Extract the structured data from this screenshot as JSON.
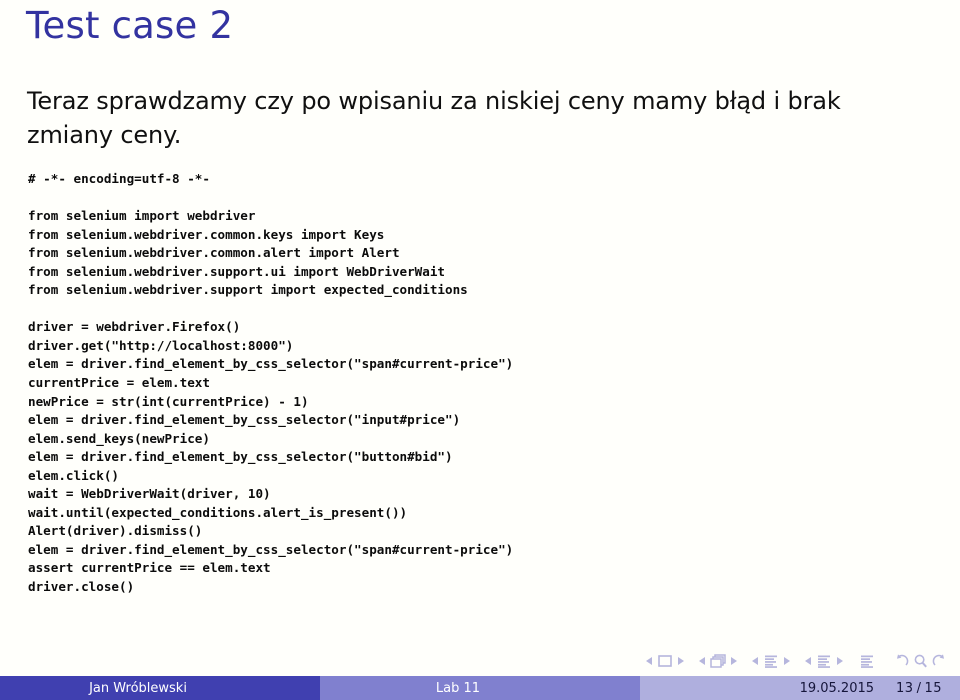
{
  "slide": {
    "title": "Test case 2",
    "body": "Teraz sprawdzamy czy po wpisaniu za niskiej ceny mamy błąd i brak zmiany ceny.",
    "code_lines": [
      "# -*- encoding=utf-8 -*-",
      "",
      "from selenium import webdriver",
      "from selenium.webdriver.common.keys import Keys",
      "from selenium.webdriver.common.alert import Alert",
      "from selenium.webdriver.support.ui import WebDriverWait",
      "from selenium.webdriver.support import expected_conditions",
      "",
      "driver = webdriver.Firefox()",
      "driver.get(\"http://localhost:8000\")",
      "elem = driver.find_element_by_css_selector(\"span#current-price\")",
      "currentPrice = elem.text",
      "newPrice = str(int(currentPrice) - 1)",
      "elem = driver.find_element_by_css_selector(\"input#price\")",
      "elem.send_keys(newPrice)",
      "elem = driver.find_element_by_css_selector(\"button#bid\")",
      "elem.click()",
      "wait = WebDriverWait(driver, 10)",
      "wait.until(expected_conditions.alert_is_present())",
      "Alert(driver).dismiss()",
      "elem = driver.find_element_by_css_selector(\"span#current-price\")",
      "assert currentPrice == elem.text",
      "driver.close()"
    ]
  },
  "navigation": {
    "icons": [
      "prev-slide-arrow-icon",
      "slide-icon",
      "next-slide-arrow-icon",
      "prev-frame-arrow-icon",
      "frames-icon",
      "next-frame-arrow-icon",
      "prev-subsection-arrow-icon",
      "subsection-icon",
      "next-subsection-arrow-icon",
      "prev-section-arrow-icon",
      "section-icon",
      "next-section-arrow-icon",
      "presentation-icon",
      "back-history-icon",
      "find-icon",
      "forward-history-icon"
    ]
  },
  "footer": {
    "author": "Jan Wróblewski",
    "title": "Lab 11",
    "date": "19.05.2015",
    "page_current": "13",
    "page_separator": "/",
    "page_total": "15"
  },
  "colors": {
    "title": "#3333a0",
    "footer_dark": "#4040b0",
    "footer_medium": "#8080cf",
    "footer_light": "#afafde",
    "nav_icon": "#b6b6dd",
    "background": "#fffffb"
  }
}
